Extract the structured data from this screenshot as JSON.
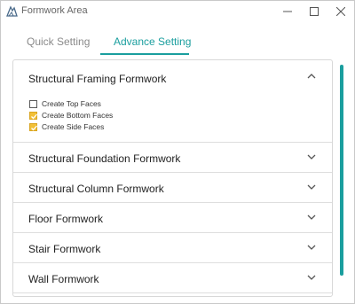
{
  "window": {
    "title": "Formwork Area",
    "controls": {
      "minimize": "—",
      "maximize": "☐",
      "close": "✕"
    }
  },
  "tabs": [
    {
      "label": "Quick Setting",
      "active": false
    },
    {
      "label": "Advance Setting",
      "active": true
    }
  ],
  "accent_color": "#1a9e9e",
  "checkbox_checked_color": "#f2c037",
  "sections": [
    {
      "title": "Structural Framing Formwork",
      "expanded": true,
      "options": [
        {
          "label": "Create Top Faces",
          "checked": false
        },
        {
          "label": "Create Bottom Faces",
          "checked": true
        },
        {
          "label": "Create Side Faces",
          "checked": true
        }
      ]
    },
    {
      "title": "Structural Foundation Formwork",
      "expanded": false
    },
    {
      "title": "Structural Column Formwork",
      "expanded": false
    },
    {
      "title": "Floor Formwork",
      "expanded": false
    },
    {
      "title": "Stair Formwork",
      "expanded": false
    },
    {
      "title": "Wall Formwork",
      "expanded": false
    }
  ]
}
